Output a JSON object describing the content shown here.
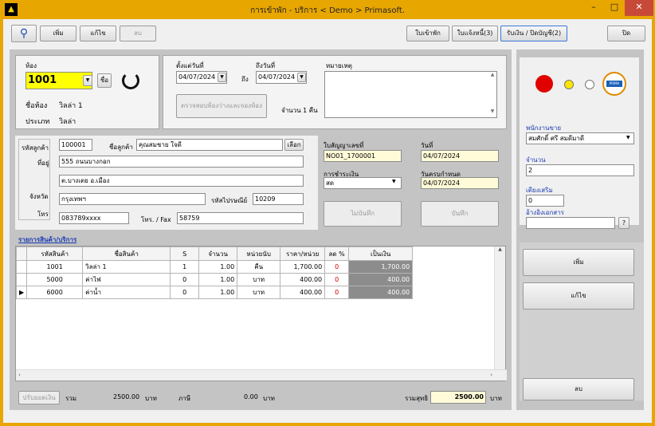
{
  "window": {
    "title": "การเข้าพัก - บริการ  < Demo > Primasoft.",
    "min": "–",
    "max": "□",
    "close": "✕"
  },
  "toolbar": {
    "add": "เพิ่ม",
    "edit": "แก้ไข",
    "delete": "ลบ",
    "checkin": "ใบเข้าพัก",
    "invoice": "ใบแจ้งหนี้(3)",
    "receipt": "รับเงิน / ปิดบัญชี(2)",
    "close": "ปิด"
  },
  "room": {
    "label": "ห้อง",
    "value": "1001",
    "name_btn": "ชื่อ",
    "room_name_label": "ชื่อห้อง",
    "room_name": "วิลล่า 1",
    "type_label": "ประเภท",
    "type": "วิลล่า"
  },
  "dates": {
    "from_label": "ตั้งแต่วันที่",
    "from": "04/07/2024",
    "to_sep": "ถึง",
    "to_label": "ถึงวันที่",
    "to": "04/07/2024",
    "note_label": "หมายเหตุ",
    "room_btn": "ตรวจสอบห้องว่างและจองห้อง",
    "nights_label": "จำนวน 1 คืน"
  },
  "customer": {
    "code_label": "รหัสลูกค้า",
    "code": "100001",
    "name_label": "ชื่อลูกค้า",
    "name": "คุณสมชาย ใจดี",
    "select_btn": "เลือก",
    "addr_label": "ที่อยู่",
    "addr1": "555 ถนนบางกอก",
    "addr2": "ต.บางเตย อ.เมือง",
    "prov_label": "จังหวัด",
    "province": "กรุงเทพฯ",
    "zip_label": "รหัสไปรษณีย์",
    "zip": "10209",
    "tel_label": "โทร",
    "tel": "083789xxxx",
    "fax_label": "โทร. / Fax",
    "fax": "58759"
  },
  "doc": {
    "contract_label": "ใบสัญญาเลขที่",
    "contract": "NO01_1700001",
    "date_label": "วันที่",
    "date": "04/07/2024",
    "pay_label": "การชำระเงิน",
    "pay": "สด",
    "due_label": "วันครบกำหนด",
    "due": "04/07/2024",
    "cancel_btn": "ไม่บันทึก",
    "save_btn": "บันทึก"
  },
  "items": {
    "title": "รายการสินค้า/บริการ",
    "headers": [
      "รหัสสินค้า",
      "ชื่อสินค้า",
      "S",
      "จำนวน",
      "หน่วยนับ",
      "ราคา/หน่วย",
      "ลด %",
      "เป็นเงิน"
    ],
    "rows": [
      [
        "1001",
        "วิลล่า 1",
        "1",
        "1.00",
        "คืน",
        "1,700.00",
        "0",
        "1,700.00"
      ],
      [
        "5000",
        "ค่าไฟ",
        "0",
        "1.00",
        "บาท",
        "400.00",
        "0",
        "400.00"
      ],
      [
        "6000",
        "ค่าน้ำ",
        "0",
        "1.00",
        "บาท",
        "400.00",
        "0",
        "400.00"
      ]
    ]
  },
  "footer": {
    "calc_btn": "ปรับยอดเงิน",
    "sum_label": "รวม",
    "sum": "2500.00",
    "baht1": "บาท",
    "vat_label": "ภาษี",
    "vat": "0.00",
    "baht2": "บาท",
    "total_label": "รวมสุทธิ",
    "total": "2500.00",
    "baht3": "บาท"
  },
  "right": {
    "staff_label": "พนักงานขาย",
    "staff": "สมศักดิ์ ศรี สมดีมาดี",
    "people_label": "จำนวน",
    "people": "2",
    "bed_label": "เตียงเสริม",
    "bed": "0",
    "ref_label": "อ้างอิงเอกสาร",
    "ref": "",
    "help": "?",
    "add": "เพิ่ม",
    "edit": "แก้ไข",
    "delete": "ลบ",
    "logo": "PRIMA"
  }
}
